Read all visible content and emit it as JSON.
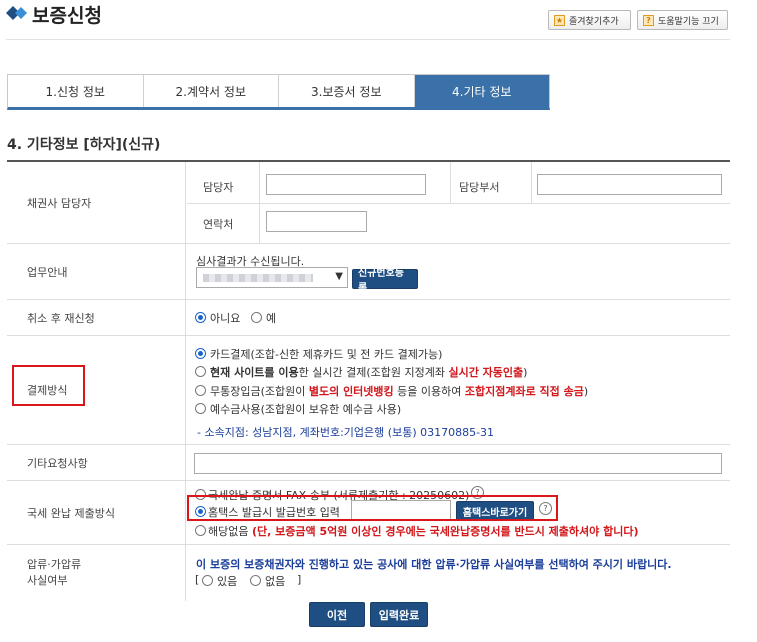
{
  "header": {
    "title": "보증신청",
    "bookmark_label": "즐겨찾기추가",
    "help_label": "도움말기능 끄기"
  },
  "tabs": [
    {
      "label": "1.신청 정보",
      "active": false
    },
    {
      "label": "2.계약서 정보",
      "active": false
    },
    {
      "label": "3.보증서 정보",
      "active": false
    },
    {
      "label": "4.기타 정보",
      "active": true
    }
  ],
  "section_title": "4. 기타정보 [하자](신규)",
  "rows": {
    "creditor": {
      "label": "채권사 담당자",
      "manager_label": "담당자",
      "manager_value": "",
      "dept_label": "담당부서",
      "dept_value": "",
      "contact_label": "연락처",
      "contact_value": ""
    },
    "business": {
      "label": "업무안내",
      "notice": "심사결과가 수신됩니다.",
      "register_button": "신규번호등록"
    },
    "reapply": {
      "label": "취소 후 재신청",
      "options": [
        "아니요",
        "예"
      ],
      "selected": "아니요"
    },
    "payment": {
      "label": "결제방식",
      "opt1": "카드결제(조합-신한 제휴카드 및 전 카드 결제가능)",
      "opt2_bold": "현재 사이트를 이용",
      "opt2_mid": "한 실시간 결제(조합원 지정계좌 ",
      "opt2_red": "실시간 자동인출",
      "opt2_end": ")",
      "opt3_pre": "무통장입금(조합원이 ",
      "opt3_red1": "별도의 인터넷뱅킹",
      "opt3_mid": " 등을 이용하여 ",
      "opt3_red2": "조합지점계좌로 직접 송금",
      "opt3_end": ")",
      "opt4": "예수금사용(조합원이 보유한 예수금 사용)",
      "account_info": "- 소속지점: 성남지점, 계좌번호:기업은행 (보통) 03170885-31"
    },
    "other_request": {
      "label": "기타요청사항",
      "value": ""
    },
    "tax": {
      "label": "국세 완납 제출방식",
      "opt_fax": "국세완납 증명서 FAX 송부 (서류제출기한 : 20250602)",
      "opt_hometax": "홈택스 발급시 발급번호 입력",
      "hometax_value": "",
      "hometax_button": "홈택스바로가기",
      "opt_none": "해당없음",
      "opt_none_note": "(단, 보증금액 5억원 이상인 경우에는 국세완납증명서를 반드시 제출하셔야 합니다)"
    },
    "seizure": {
      "label_line1": "압류·가압류",
      "label_line2": "사실여부",
      "question": "이 보증의 보증채권자와 진행하고 있는 공사에 대한 압류·가압류 사실여부를 선택하여 주시기 바랍니다.",
      "bracket_open": "[",
      "yes": "있음",
      "no": "없음",
      "bracket_close": "]"
    }
  },
  "buttons": {
    "prev": "이전",
    "submit": "입력완료"
  },
  "colors": {
    "accent": "#3a71a8",
    "navy_button": "#1f4f82",
    "highlight_red": "#d9161a",
    "info_blue": "#1b3e9a"
  }
}
